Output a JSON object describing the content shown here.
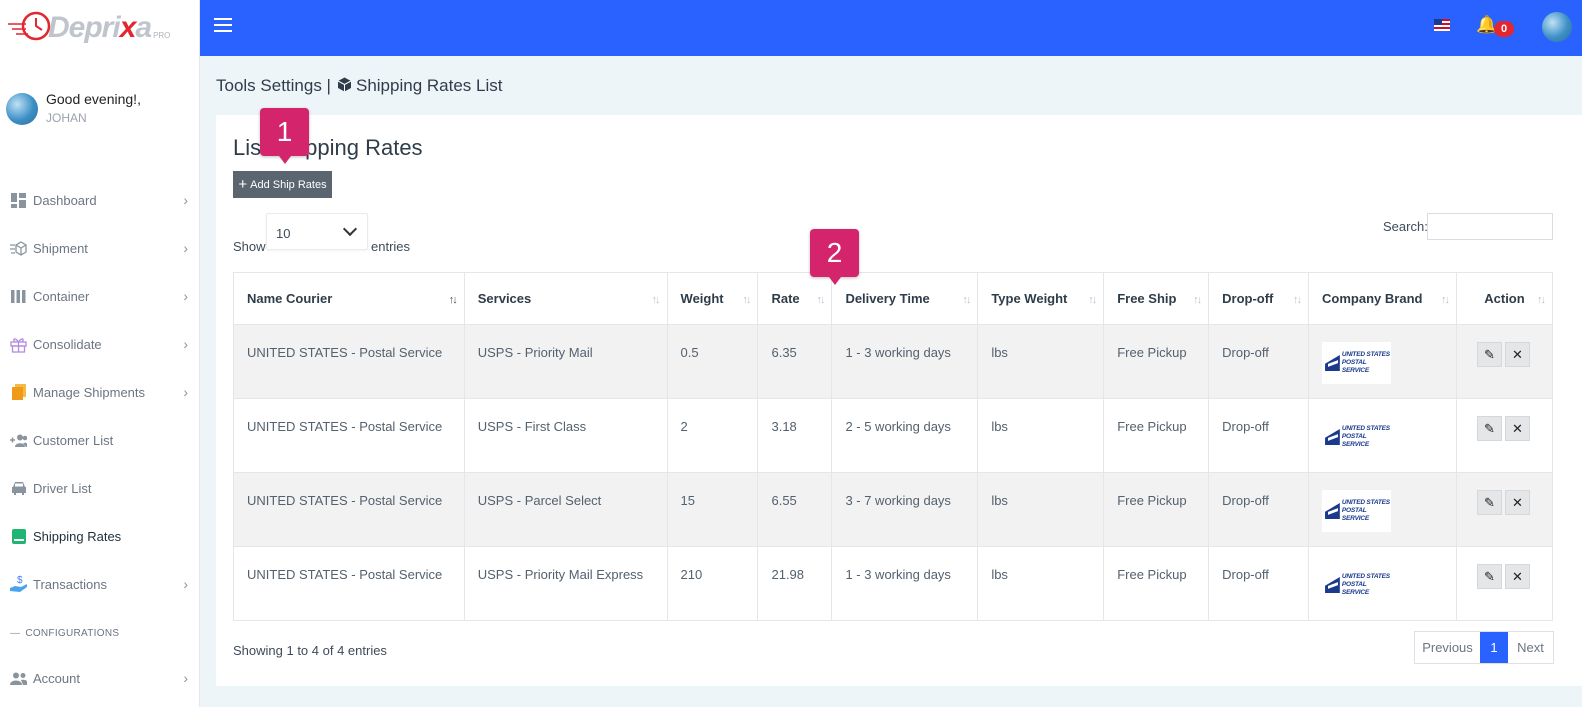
{
  "brand": {
    "logo_prefix": "Depri",
    "logo_x": "x",
    "logo_suffix": "a",
    "logo_sub": "PRO"
  },
  "user": {
    "greeting": "Good evening!,",
    "name": "JOHAN"
  },
  "sidebar": {
    "items": [
      {
        "label": "Dashboard",
        "icon": "dashboard-icon",
        "chevron": true
      },
      {
        "label": "Shipment",
        "icon": "shipment-box-icon",
        "chevron": true
      },
      {
        "label": "Container",
        "icon": "container-bars-icon",
        "chevron": true
      },
      {
        "label": "Consolidate",
        "icon": "gift-icon",
        "chevron": true
      },
      {
        "label": "Manage Shipments",
        "icon": "stack-icon",
        "chevron": true
      },
      {
        "label": "Customer List",
        "icon": "user-add-icon",
        "chevron": false
      },
      {
        "label": "Driver List",
        "icon": "car-icon",
        "chevron": false
      },
      {
        "label": "Shipping Rates",
        "icon": "rates-icon",
        "chevron": false,
        "active": true
      },
      {
        "label": "Transactions",
        "icon": "hand-dollar-icon",
        "chevron": true
      }
    ],
    "section_label": "CONFIGURATIONS",
    "account_label": "Account"
  },
  "topbar": {
    "notification_count": "0",
    "accent": "#2962ff"
  },
  "breadcrumb": {
    "part1": "Tools Settings |",
    "part2": "Shipping Rates List"
  },
  "card": {
    "title": "List Shipping Rates",
    "add_button": "Add Ship Rates",
    "show_label": "Show",
    "page_size": "10",
    "entries_label": "entries",
    "search_label": "Search:",
    "search_value": ""
  },
  "table": {
    "headers": [
      "Name Courier",
      "Services",
      "Weight",
      "Rate",
      "Delivery Time",
      "Type Weight",
      "Free Ship",
      "Drop-off",
      "Company Brand",
      "Action"
    ],
    "rows": [
      {
        "courier": "UNITED STATES - Postal Service",
        "service": "USPS - Priority Mail",
        "weight": "0.5",
        "rate": "6.35",
        "delivery": "1 - 3 working days",
        "type_weight": "lbs",
        "free_ship": "Free Pickup",
        "dropoff": "Drop-off"
      },
      {
        "courier": "UNITED STATES - Postal Service",
        "service": "USPS - First Class",
        "weight": "2",
        "rate": "3.18",
        "delivery": "2 - 5 working days",
        "type_weight": "lbs",
        "free_ship": "Free Pickup",
        "dropoff": "Drop-off"
      },
      {
        "courier": "UNITED STATES - Postal Service",
        "service": "USPS - Parcel Select",
        "weight": "15",
        "rate": "6.55",
        "delivery": "3 - 7 working days",
        "type_weight": "lbs",
        "free_ship": "Free Pickup",
        "dropoff": "Drop-off"
      },
      {
        "courier": "UNITED STATES - Postal Service",
        "service": "USPS - Priority Mail Express",
        "weight": "210",
        "rate": "21.98",
        "delivery": "1 - 3 working days",
        "type_weight": "lbs",
        "free_ship": "Free Pickup",
        "dropoff": "Drop-off"
      }
    ],
    "brand_line1": "UNITED STATES",
    "brand_line2": "POSTAL SERVICE"
  },
  "footer": {
    "showing": "Showing 1 to 4 of 4 entries",
    "prev": "Previous",
    "page": "1",
    "next": "Next"
  },
  "callouts": {
    "one": "1",
    "two": "2",
    "color": "#d4246b"
  }
}
